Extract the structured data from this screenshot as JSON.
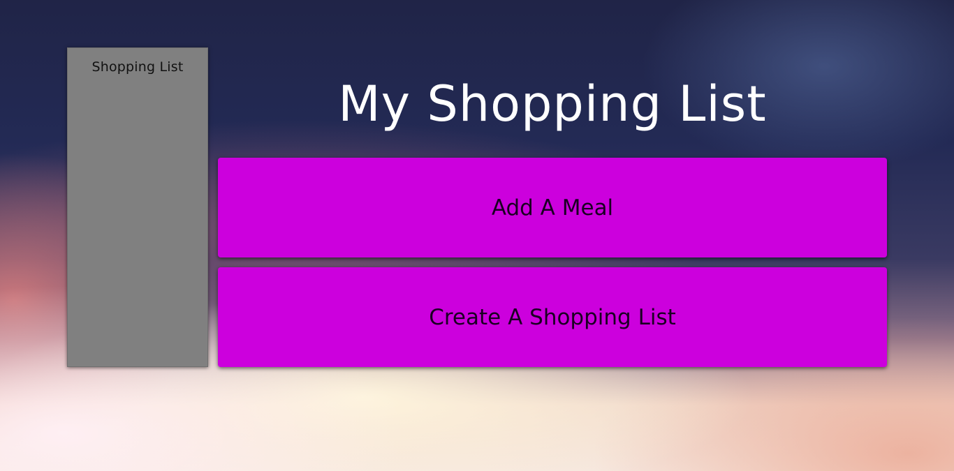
{
  "sidebar": {
    "title": "Shopping List"
  },
  "main": {
    "title": "My Shopping List",
    "buttons": {
      "add_meal": "Add A Meal",
      "create_list": "Create A Shopping List"
    }
  },
  "colors": {
    "button_background": "#cc00dd",
    "sidebar_background": "#808080",
    "title_text": "#ffffff"
  }
}
